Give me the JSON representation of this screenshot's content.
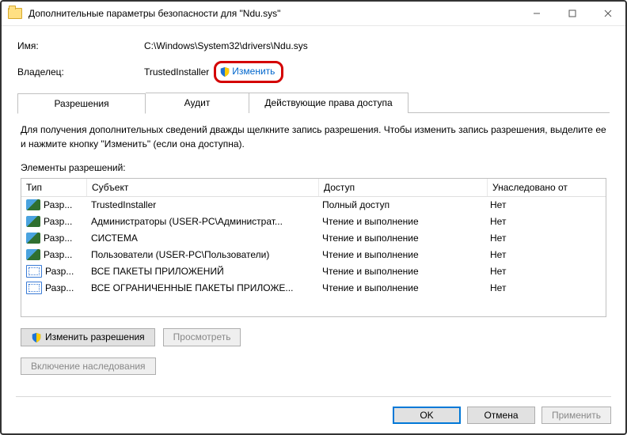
{
  "titlebar": {
    "title": "Дополнительные параметры безопасности  для \"Ndu.sys\""
  },
  "labels": {
    "name": "Имя:",
    "owner": "Владелец:",
    "elements": "Элементы разрешений:"
  },
  "values": {
    "name": "C:\\Windows\\System32\\drivers\\Ndu.sys",
    "owner": "TrustedInstaller",
    "change": "Изменить"
  },
  "tabs": {
    "t1": "Разрешения",
    "t2": "Аудит",
    "t3": "Действующие права доступа"
  },
  "hint": "Для получения дополнительных сведений дважды щелкните запись разрешения. Чтобы изменить запись разрешения, выделите ее и нажмите кнопку \"Изменить\" (если она доступна).",
  "grid": {
    "headers": {
      "c1": "Тип",
      "c2": "Субъект",
      "c3": "Доступ",
      "c4": "Унаследовано от"
    },
    "rows": [
      {
        "icon": "users",
        "type": "Разр...",
        "subject": "TrustedInstaller",
        "access": "Полный доступ",
        "inh": "Нет"
      },
      {
        "icon": "users",
        "type": "Разр...",
        "subject": "Администраторы (USER-PC\\Администрат...",
        "access": "Чтение и выполнение",
        "inh": "Нет"
      },
      {
        "icon": "users",
        "type": "Разр...",
        "subject": "СИСТЕМА",
        "access": "Чтение и выполнение",
        "inh": "Нет"
      },
      {
        "icon": "users",
        "type": "Разр...",
        "subject": "Пользователи (USER-PC\\Пользователи)",
        "access": "Чтение и выполнение",
        "inh": "Нет"
      },
      {
        "icon": "pkg",
        "type": "Разр...",
        "subject": "ВСЕ ПАКЕТЫ ПРИЛОЖЕНИЙ",
        "access": "Чтение и выполнение",
        "inh": "Нет"
      },
      {
        "icon": "pkg",
        "type": "Разр...",
        "subject": "ВСЕ ОГРАНИЧЕННЫЕ ПАКЕТЫ ПРИЛОЖЕ...",
        "access": "Чтение и выполнение",
        "inh": "Нет"
      }
    ]
  },
  "buttons": {
    "changePerm": "Изменить разрешения",
    "view": "Просмотреть",
    "enableInherit": "Включение наследования",
    "ok": "OK",
    "cancel": "Отмена",
    "apply": "Применить"
  }
}
